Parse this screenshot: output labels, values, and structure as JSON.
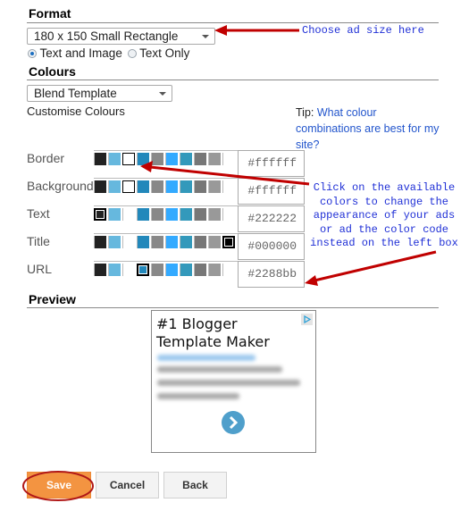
{
  "format": {
    "title": "Format",
    "size_select": {
      "value": "180 x 150 Small Rectangle"
    },
    "ad_type": [
      {
        "label": "Text and Image",
        "checked": true
      },
      {
        "label": "Text Only",
        "checked": false
      }
    ]
  },
  "colours": {
    "title": "Colours",
    "template_select": {
      "value": "Blend Template"
    },
    "customise_label": "Customise Colours",
    "tip": {
      "prefix": "Tip:",
      "link": "What colour combinations are best for my site?"
    },
    "palette": [
      "#222222",
      "#66b8de",
      "#ffffff",
      "#2288bb",
      "#888888",
      "#33aaff",
      "#3399bb",
      "#777777",
      "#999999"
    ],
    "rows": [
      {
        "label": "Border",
        "value": "#ffffff",
        "selected_index": 2
      },
      {
        "label": "Background",
        "value": "#ffffff",
        "selected_index": 2
      },
      {
        "label": "Text",
        "value": "#222222",
        "selected_index": 0
      },
      {
        "label": "Title",
        "value": "#000000",
        "selected_index": 9
      },
      {
        "label": "URL",
        "value": "#2288bb",
        "selected_index": 3
      }
    ]
  },
  "preview": {
    "title": "Preview",
    "ad_headline": "#1 Blogger Template Maker",
    "ad_choices_icon": "adchoices-icon",
    "next_icon": "chevron-right-circle-icon"
  },
  "buttons": {
    "save": "Save",
    "cancel": "Cancel",
    "back": "Back"
  },
  "annotations": {
    "size_note": "Choose ad size here",
    "colors_note": "Click on the available colors to change the appearance of your ads or ad the color code instead on the left box"
  },
  "colors": {
    "accent_save": "#f39441",
    "annotation_arrow": "#c00000",
    "annotation_text": "#1f2fd6",
    "link": "#2255cc"
  }
}
